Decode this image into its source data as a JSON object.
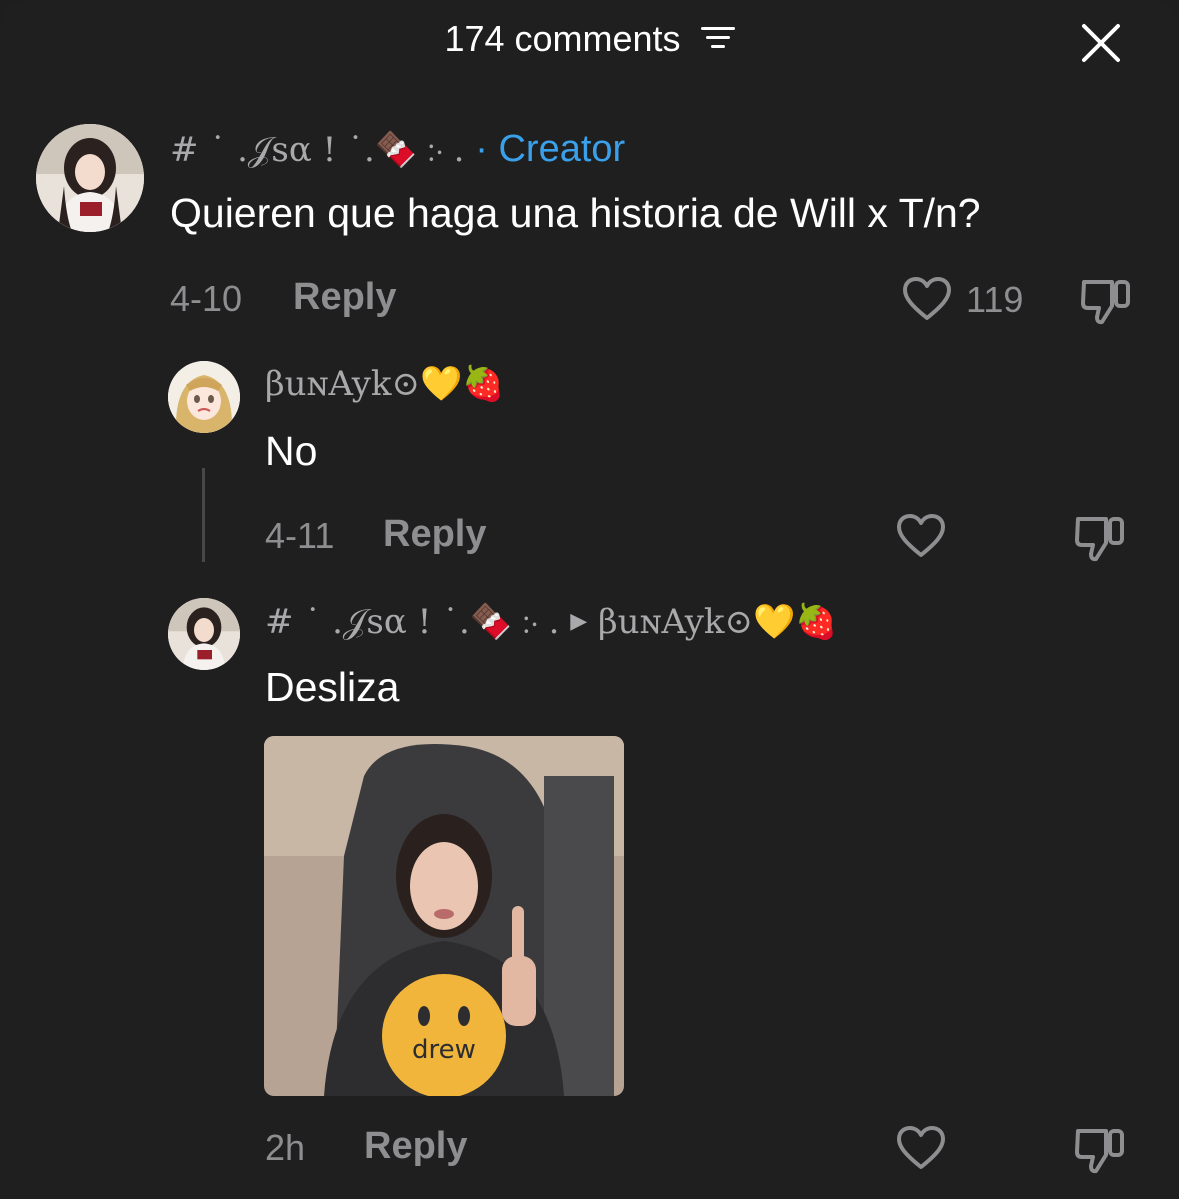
{
  "header": {
    "title": "174 comments"
  },
  "comments": [
    {
      "username": "# ˙ .𝒥sα ! ˙.🍫 ჻ .",
      "badge": "· Creator",
      "text": "Quieren que haga una historia de Will x T/n?",
      "date": "4-10",
      "reply_label": "Reply",
      "likes": "119"
    },
    {
      "username": "βuɴAyk⊙💛🍓",
      "text": "No",
      "date": "4-11",
      "reply_label": "Reply"
    },
    {
      "username": "# ˙ .𝒥sα ! ˙.🍫 ჻ .",
      "reply_to": "βuɴAyk⊙💛🍓",
      "text": "Desliza",
      "date": "2h",
      "reply_label": "Reply",
      "image_text": "drew"
    }
  ],
  "colors": {
    "background": "#1f1f20",
    "accent": "#3aa0ea",
    "muted": "#8e8e91"
  },
  "icons": [
    "sort-icon",
    "close-icon",
    "heart-icon",
    "dislike-icon"
  ]
}
